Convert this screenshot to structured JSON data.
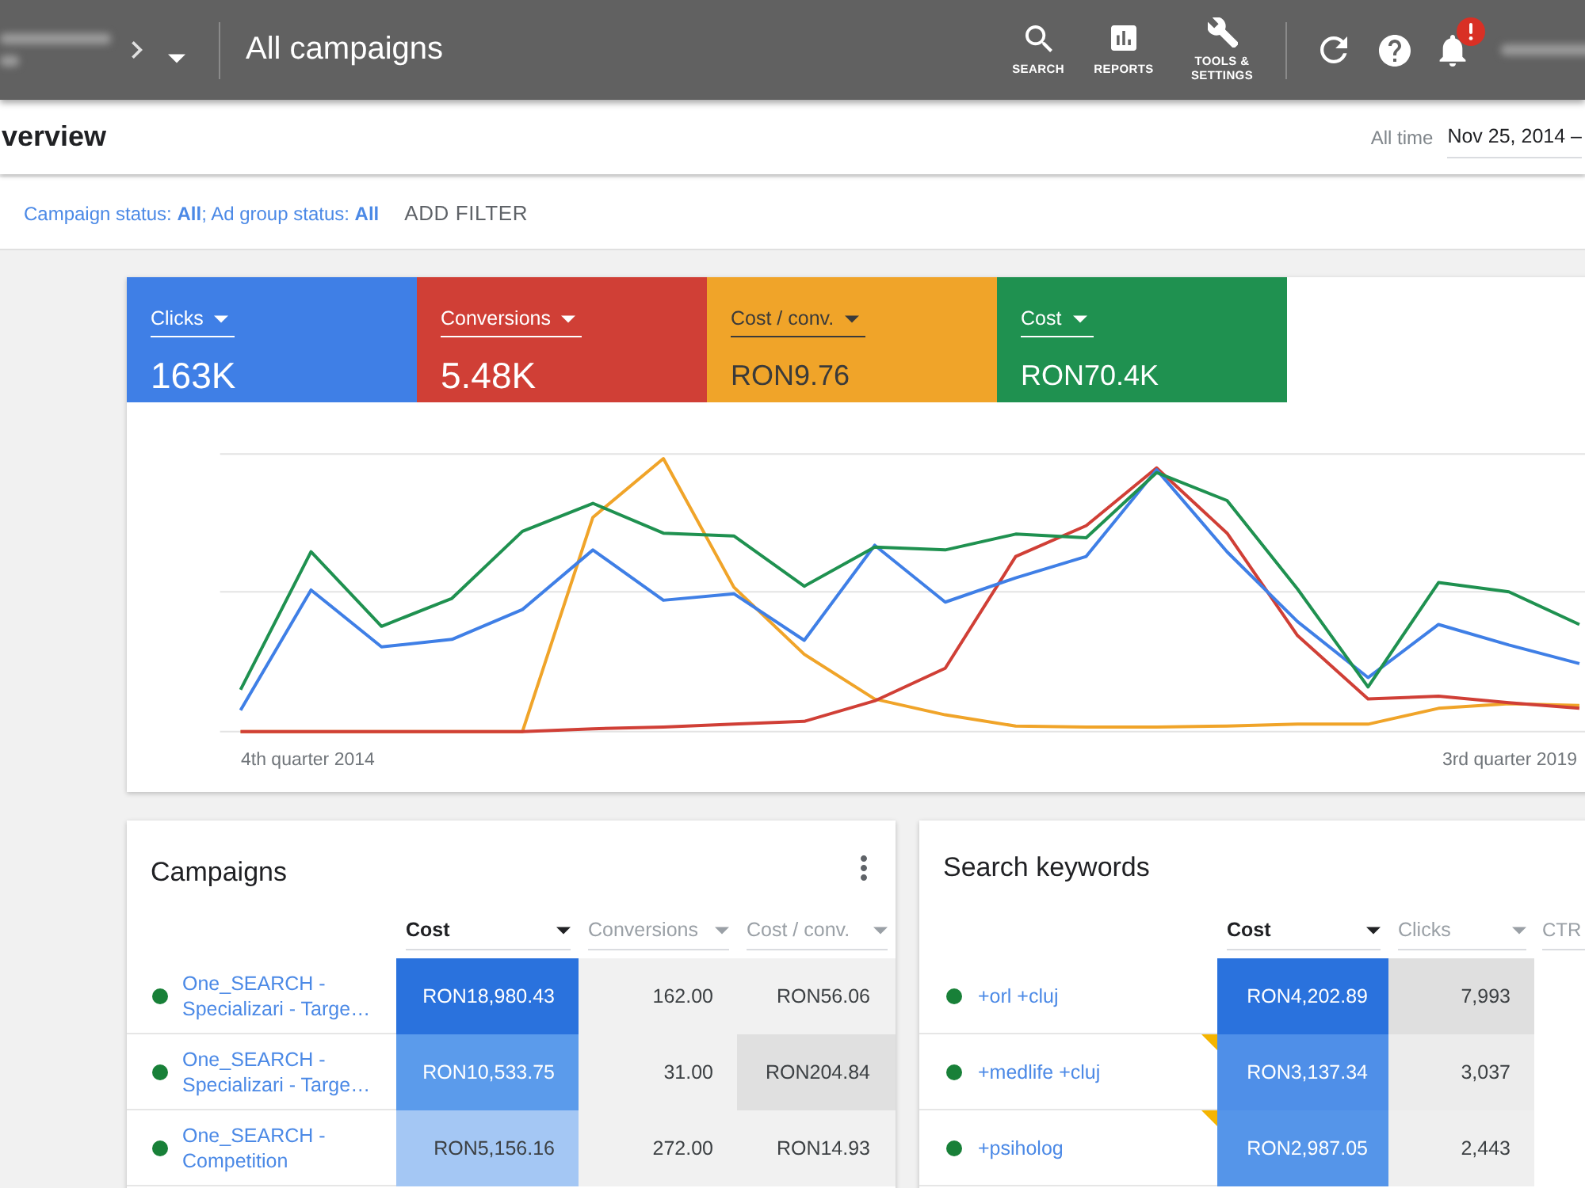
{
  "top_bar": {
    "title": "All campaigns",
    "nav": [
      {
        "kind": "search",
        "label": "SEARCH"
      },
      {
        "kind": "reports",
        "label": "REPORTS"
      },
      {
        "kind": "tools",
        "label": "TOOLS & SETTINGS"
      }
    ],
    "actions": [
      {
        "kind": "refresh"
      },
      {
        "kind": "help"
      },
      {
        "kind": "notifications",
        "alert": true
      }
    ]
  },
  "page_header": {
    "title": "verview",
    "range_label": "All time",
    "date_range": "Nov 25, 2014 –"
  },
  "filter_bar": {
    "filters": "Campaign status: **All**; Ad group status: **All**",
    "add_filter": "ADD FILTER"
  },
  "metrics": [
    {
      "label": "Clicks",
      "value": "163K",
      "color": "#3f7fe6"
    },
    {
      "label": "Conversions",
      "value": "5.48K",
      "color": "#d03f36"
    },
    {
      "label": "Cost / conv.",
      "value": "RON9.76",
      "color": "#f0a429"
    },
    {
      "label": "Cost",
      "value": "RON70.4K",
      "color": "#1f9150"
    }
  ],
  "chart": {
    "x_start": "4th quarter 2014",
    "x_end": "3rd quarter 2019"
  },
  "campaigns": {
    "title": "Campaigns",
    "columns": [
      {
        "label": "Cost",
        "selected": true,
        "menu": true
      },
      {
        "label": "Conversions",
        "selected": false,
        "menu": true
      },
      {
        "label": "Cost / conv.",
        "selected": false,
        "menu": true
      }
    ],
    "rows": [
      {
        "name": "One_SEARCH - Specializari - Targe…",
        "color": "#188038",
        "cells": [
          {
            "text": "RON18,980.43",
            "color": "#2a72dd"
          },
          {
            "text": "162.00",
            "color": "#f1f1f1"
          },
          {
            "text": "RON56.06",
            "color": "#f1f1f1"
          }
        ]
      },
      {
        "name": "One_SEARCH - Specializari - Targe…",
        "color": "#188038",
        "cells": [
          {
            "text": "RON10,533.75",
            "color": "#5b9beb"
          },
          {
            "text": "31.00",
            "color": "#f1f1f1"
          },
          {
            "text": "RON204.84",
            "color": "#e0e0e0"
          }
        ]
      },
      {
        "name": "One_SEARCH - Competition",
        "color": "#188038",
        "cells": [
          {
            "text": "RON5,156.16",
            "color": "#a4c7f4"
          },
          {
            "text": "272.00",
            "color": "#f1f1f1"
          },
          {
            "text": "RON14.93",
            "color": "#f1f1f1"
          }
        ]
      }
    ]
  },
  "keywords": {
    "title": "Search keywords",
    "columns": [
      {
        "label": "Cost",
        "selected": true,
        "menu": true
      },
      {
        "label": "Clicks",
        "selected": false,
        "menu": true
      },
      {
        "label": "CTR",
        "selected": false,
        "menu": false
      }
    ],
    "rows": [
      {
        "name": "+orl +cluj",
        "color": "#188038",
        "flagged": false,
        "cells": [
          {
            "text": "RON4,202.89",
            "color": "#2a72dd"
          },
          {
            "text": "7,993",
            "color": "#dfdfdf"
          }
        ]
      },
      {
        "name": "+medlife +cluj",
        "color": "#188038",
        "flagged": true,
        "cells": [
          {
            "text": "RON3,137.34",
            "color": "#4f8fe8"
          },
          {
            "text": "3,037",
            "color": "#ececec"
          }
        ]
      },
      {
        "name": "+psiholog",
        "color": "#188038",
        "flagged": true,
        "cells": [
          {
            "text": "RON2,987.05",
            "color": "#5595e9"
          },
          {
            "text": "2,443",
            "color": "#efefef"
          }
        ]
      }
    ]
  }
}
